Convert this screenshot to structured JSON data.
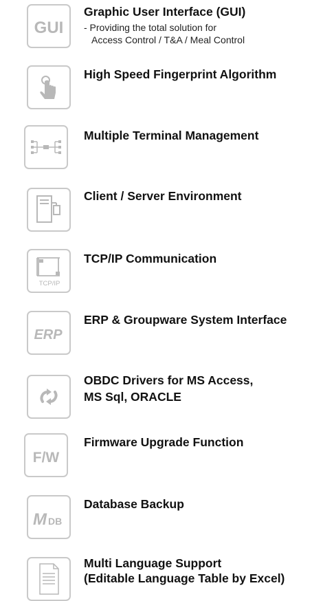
{
  "icon_color": "#b8b8b8",
  "border_color": "#c9c9c9",
  "features": [
    {
      "icon": "gui-icon",
      "icon_text": "GUI",
      "title": "Graphic User Interface (GUI)",
      "desc1": "- Providing the total solution for",
      "desc2": "Access Control / T&A / Meal Control"
    },
    {
      "icon": "fingerprint-touch-icon",
      "title": "High Speed Fingerprint Algorithm"
    },
    {
      "icon": "network-nodes-icon",
      "title": "Multiple Terminal Management"
    },
    {
      "icon": "client-server-icon",
      "title": "Client / Server Environment"
    },
    {
      "icon": "tcpip-icon",
      "icon_text": "TCP/IP",
      "title": "TCP/IP Communication"
    },
    {
      "icon": "erp-icon",
      "icon_text": "ERP",
      "title": "ERP & Groupware System Interface"
    },
    {
      "icon": "sync-arrows-icon",
      "title_line1": "OBDC Drivers for MS Access,",
      "title_line2": "MS Sql, ORACLE"
    },
    {
      "icon": "firmware-icon",
      "icon_text": "F/W",
      "title": "Firmware Upgrade Function"
    },
    {
      "icon": "database-icon",
      "icon_text_main": "M",
      "icon_text_sub": "DB",
      "title": "Database Backup"
    },
    {
      "icon": "document-icon",
      "title_line1": "Multi Language Support",
      "title_line2": "(Editable Language Table by Excel)"
    }
  ]
}
